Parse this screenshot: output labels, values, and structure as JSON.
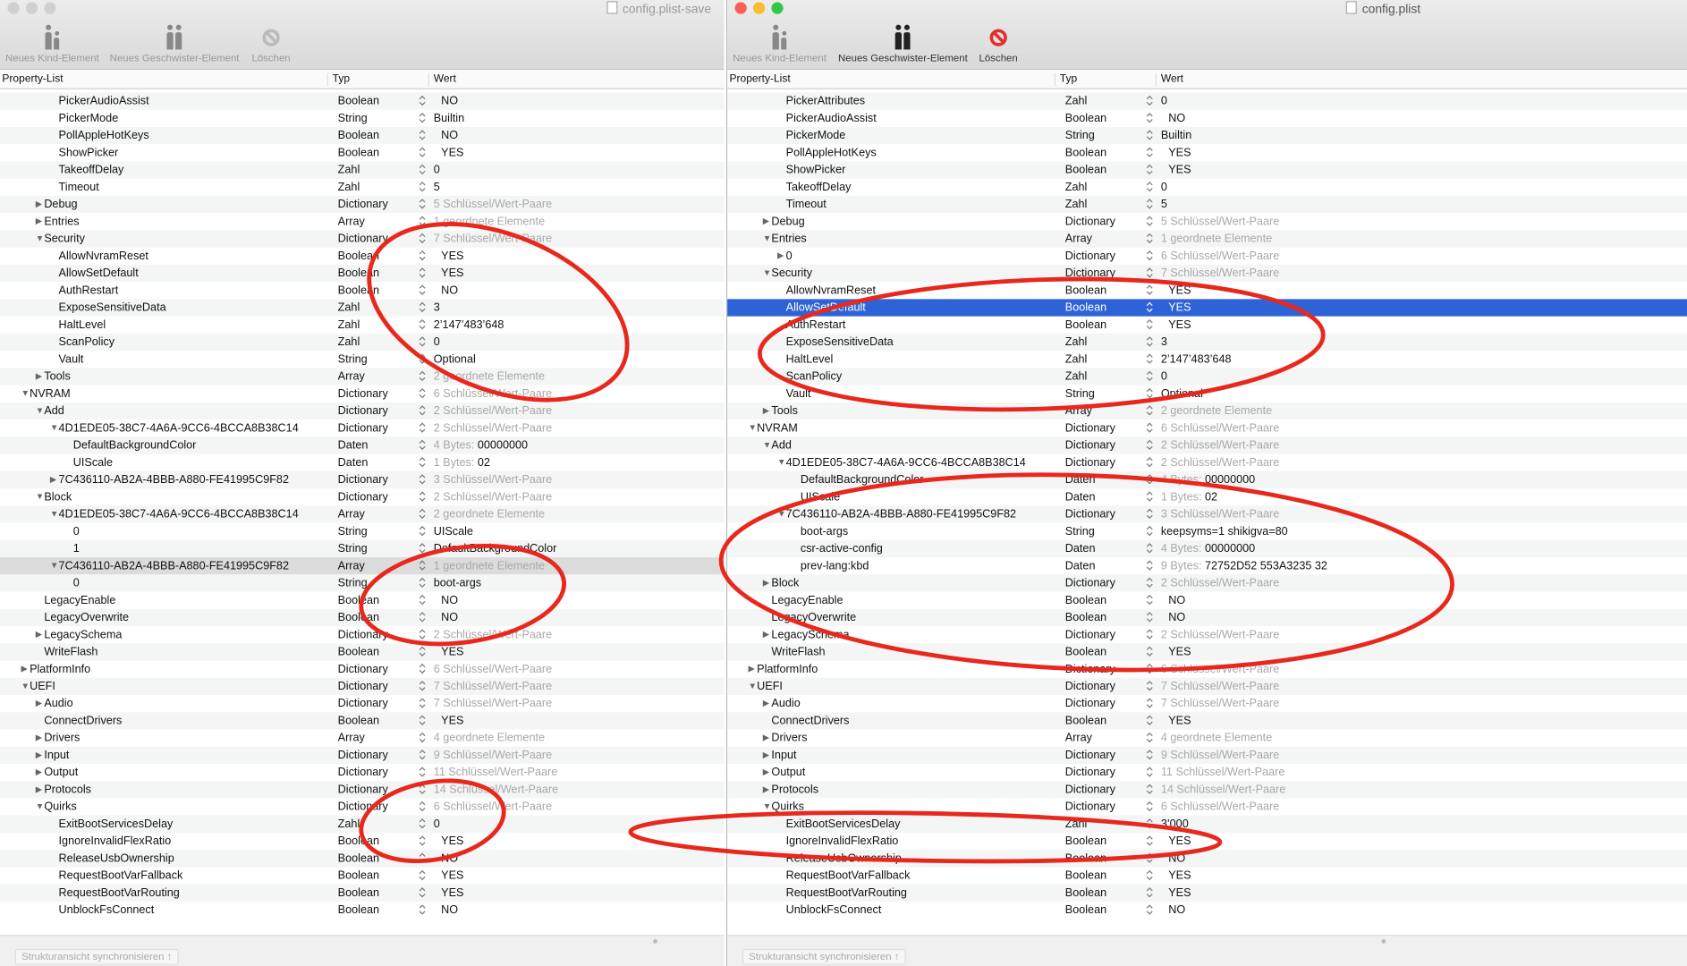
{
  "left": {
    "title": "config.plist-save",
    "toolbar": [
      "Neues Kind-Element",
      "Neues Geschwister-Element",
      "Löschen"
    ],
    "columns": [
      "Property-List",
      "Typ",
      "Wert"
    ],
    "sync": "Strukturansicht synchronisieren ↑",
    "rows": [
      [
        3,
        "",
        "PickerAudioAssist",
        "Boolean",
        "",
        "NO"
      ],
      [
        3,
        "",
        "PickerMode",
        "String",
        "",
        "Builtin"
      ],
      [
        3,
        "",
        "PollAppleHotKeys",
        "Boolean",
        "",
        "NO"
      ],
      [
        3,
        "",
        "ShowPicker",
        "Boolean",
        "",
        "YES"
      ],
      [
        3,
        "",
        "TakeoffDelay",
        "Zahl",
        "",
        "0"
      ],
      [
        3,
        "",
        "Timeout",
        "Zahl",
        "",
        "5"
      ],
      [
        2,
        "c",
        "Debug",
        "Dictionary",
        "5 Schlüssel/Wert-Paare",
        ""
      ],
      [
        2,
        "c",
        "Entries",
        "Array",
        "1 geordnete Elemente",
        ""
      ],
      [
        2,
        "o",
        "Security",
        "Dictionary",
        "7 Schlüssel/Wert-Paare",
        ""
      ],
      [
        3,
        "",
        "AllowNvramReset",
        "Boolean",
        "",
        "YES"
      ],
      [
        3,
        "",
        "AllowSetDefault",
        "Boolean",
        "",
        "YES"
      ],
      [
        3,
        "",
        "AuthRestart",
        "Boolean",
        "",
        "NO"
      ],
      [
        3,
        "",
        "ExposeSensitiveData",
        "Zahl",
        "",
        "3"
      ],
      [
        3,
        "",
        "HaltLevel",
        "Zahl",
        "",
        "2’147’483’648"
      ],
      [
        3,
        "",
        "ScanPolicy",
        "Zahl",
        "",
        "0"
      ],
      [
        3,
        "",
        "Vault",
        "String",
        "",
        "Optional"
      ],
      [
        2,
        "c",
        "Tools",
        "Array",
        "2 geordnete Elemente",
        ""
      ],
      [
        1,
        "o",
        "NVRAM",
        "Dictionary",
        "6 Schlüssel/Wert-Paare",
        ""
      ],
      [
        2,
        "o",
        "Add",
        "Dictionary",
        "2 Schlüssel/Wert-Paare",
        ""
      ],
      [
        3,
        "o",
        "4D1EDE05-38C7-4A6A-9CC6-4BCCA8B38C14",
        "Dictionary",
        "2 Schlüssel/Wert-Paare",
        ""
      ],
      [
        4,
        "",
        "DefaultBackgroundColor",
        "Daten",
        "4 Bytes:",
        "00000000"
      ],
      [
        4,
        "",
        "UIScale",
        "Daten",
        "1 Bytes:",
        "02"
      ],
      [
        3,
        "c",
        "7C436110-AB2A-4BBB-A880-FE41995C9F82",
        "Dictionary",
        "3 Schlüssel/Wert-Paare",
        ""
      ],
      [
        2,
        "o",
        "Block",
        "Dictionary",
        "2 Schlüssel/Wert-Paare",
        ""
      ],
      [
        3,
        "o",
        "4D1EDE05-38C7-4A6A-9CC6-4BCCA8B38C14",
        "Array",
        "2 geordnete Elemente",
        ""
      ],
      [
        4,
        "",
        "0",
        "String",
        "",
        "UIScale"
      ],
      [
        4,
        "",
        "1",
        "String",
        "",
        "DefaultBackgroundColor"
      ],
      [
        3,
        "o",
        "7C436110-AB2A-4BBB-A880-FE41995C9F82",
        "Array",
        "1 geordnete Elemente",
        "",
        "grey"
      ],
      [
        4,
        "",
        "0",
        "String",
        "",
        "boot-args"
      ],
      [
        2,
        "",
        "LegacyEnable",
        "Boolean",
        "",
        "NO"
      ],
      [
        2,
        "",
        "LegacyOverwrite",
        "Boolean",
        "",
        "NO"
      ],
      [
        2,
        "c",
        "LegacySchema",
        "Dictionary",
        "2 Schlüssel/Wert-Paare",
        ""
      ],
      [
        2,
        "",
        "WriteFlash",
        "Boolean",
        "",
        "YES"
      ],
      [
        1,
        "c",
        "PlatformInfo",
        "Dictionary",
        "6 Schlüssel/Wert-Paare",
        ""
      ],
      [
        1,
        "o",
        "UEFI",
        "Dictionary",
        "7 Schlüssel/Wert-Paare",
        ""
      ],
      [
        2,
        "c",
        "Audio",
        "Dictionary",
        "7 Schlüssel/Wert-Paare",
        ""
      ],
      [
        2,
        "",
        "ConnectDrivers",
        "Boolean",
        "",
        "YES"
      ],
      [
        2,
        "c",
        "Drivers",
        "Array",
        "4 geordnete Elemente",
        ""
      ],
      [
        2,
        "c",
        "Input",
        "Dictionary",
        "9 Schlüssel/Wert-Paare",
        ""
      ],
      [
        2,
        "c",
        "Output",
        "Dictionary",
        "11 Schlüssel/Wert-Paare",
        ""
      ],
      [
        2,
        "c",
        "Protocols",
        "Dictionary",
        "14 Schlüssel/Wert-Paare",
        ""
      ],
      [
        2,
        "o",
        "Quirks",
        "Dictionary",
        "6 Schlüssel/Wert-Paare",
        ""
      ],
      [
        3,
        "",
        "ExitBootServicesDelay",
        "Zahl",
        "",
        "0"
      ],
      [
        3,
        "",
        "IgnoreInvalidFlexRatio",
        "Boolean",
        "",
        "YES"
      ],
      [
        3,
        "",
        "ReleaseUsbOwnership",
        "Boolean",
        "",
        "NO"
      ],
      [
        3,
        "",
        "RequestBootVarFallback",
        "Boolean",
        "",
        "YES"
      ],
      [
        3,
        "",
        "RequestBootVarRouting",
        "Boolean",
        "",
        "YES"
      ],
      [
        3,
        "",
        "UnblockFsConnect",
        "Boolean",
        "",
        "NO"
      ]
    ]
  },
  "right": {
    "title": "config.plist",
    "toolbar": [
      "Neues Kind-Element",
      "Neues Geschwister-Element",
      "Löschen"
    ],
    "columns": [
      "Property-List",
      "Typ",
      "Wert"
    ],
    "sync": "Strukturansicht synchronisieren ↑",
    "rows": [
      [
        3,
        "",
        "PickerAttributes",
        "Zahl",
        "",
        "0"
      ],
      [
        3,
        "",
        "PickerAudioAssist",
        "Boolean",
        "",
        "NO"
      ],
      [
        3,
        "",
        "PickerMode",
        "String",
        "",
        "Builtin"
      ],
      [
        3,
        "",
        "PollAppleHotKeys",
        "Boolean",
        "",
        "YES"
      ],
      [
        3,
        "",
        "ShowPicker",
        "Boolean",
        "",
        "YES"
      ],
      [
        3,
        "",
        "TakeoffDelay",
        "Zahl",
        "",
        "0"
      ],
      [
        3,
        "",
        "Timeout",
        "Zahl",
        "",
        "5"
      ],
      [
        2,
        "c",
        "Debug",
        "Dictionary",
        "5 Schlüssel/Wert-Paare",
        ""
      ],
      [
        2,
        "o",
        "Entries",
        "Array",
        "1 geordnete Elemente",
        ""
      ],
      [
        3,
        "c",
        "0",
        "Dictionary",
        "6 Schlüssel/Wert-Paare",
        ""
      ],
      [
        2,
        "o",
        "Security",
        "Dictionary",
        "7 Schlüssel/Wert-Paare",
        ""
      ],
      [
        3,
        "",
        "AllowNvramReset",
        "Boolean",
        "",
        "YES"
      ],
      [
        3,
        "",
        "AllowSetDefault",
        "Boolean",
        "",
        "YES",
        "sel"
      ],
      [
        3,
        "",
        "AuthRestart",
        "Boolean",
        "",
        "YES"
      ],
      [
        3,
        "",
        "ExposeSensitiveData",
        "Zahl",
        "",
        "3"
      ],
      [
        3,
        "",
        "HaltLevel",
        "Zahl",
        "",
        "2’147’483’648"
      ],
      [
        3,
        "",
        "ScanPolicy",
        "Zahl",
        "",
        "0"
      ],
      [
        3,
        "",
        "Vault",
        "String",
        "",
        "Optional"
      ],
      [
        2,
        "c",
        "Tools",
        "Array",
        "2 geordnete Elemente",
        ""
      ],
      [
        1,
        "o",
        "NVRAM",
        "Dictionary",
        "6 Schlüssel/Wert-Paare",
        ""
      ],
      [
        2,
        "o",
        "Add",
        "Dictionary",
        "2 Schlüssel/Wert-Paare",
        ""
      ],
      [
        3,
        "o",
        "4D1EDE05-38C7-4A6A-9CC6-4BCCA8B38C14",
        "Dictionary",
        "2 Schlüssel/Wert-Paare",
        ""
      ],
      [
        4,
        "",
        "DefaultBackgroundColor",
        "Daten",
        "4 Bytes:",
        "00000000"
      ],
      [
        4,
        "",
        "UIScale",
        "Daten",
        "1 Bytes:",
        "02"
      ],
      [
        3,
        "o",
        "7C436110-AB2A-4BBB-A880-FE41995C9F82",
        "Dictionary",
        "3 Schlüssel/Wert-Paare",
        ""
      ],
      [
        4,
        "",
        "boot-args",
        "String",
        "",
        "keepsyms=1 shikigva=80"
      ],
      [
        4,
        "",
        "csr-active-config",
        "Daten",
        "4 Bytes:",
        "00000000"
      ],
      [
        4,
        "",
        "prev-lang:kbd",
        "Daten",
        "9 Bytes:",
        "72752D52 553A3235 32"
      ],
      [
        2,
        "c",
        "Block",
        "Dictionary",
        "2 Schlüssel/Wert-Paare",
        ""
      ],
      [
        2,
        "",
        "LegacyEnable",
        "Boolean",
        "",
        "NO"
      ],
      [
        2,
        "",
        "LegacyOverwrite",
        "Boolean",
        "",
        "NO"
      ],
      [
        2,
        "c",
        "LegacySchema",
        "Dictionary",
        "2 Schlüssel/Wert-Paare",
        ""
      ],
      [
        2,
        "",
        "WriteFlash",
        "Boolean",
        "",
        "YES"
      ],
      [
        1,
        "c",
        "PlatformInfo",
        "Dictionary",
        "6 Schlüssel/Wert-Paare",
        ""
      ],
      [
        1,
        "o",
        "UEFI",
        "Dictionary",
        "7 Schlüssel/Wert-Paare",
        ""
      ],
      [
        2,
        "c",
        "Audio",
        "Dictionary",
        "7 Schlüssel/Wert-Paare",
        ""
      ],
      [
        2,
        "",
        "ConnectDrivers",
        "Boolean",
        "",
        "YES"
      ],
      [
        2,
        "c",
        "Drivers",
        "Array",
        "4 geordnete Elemente",
        ""
      ],
      [
        2,
        "c",
        "Input",
        "Dictionary",
        "9 Schlüssel/Wert-Paare",
        ""
      ],
      [
        2,
        "c",
        "Output",
        "Dictionary",
        "11 Schlüssel/Wert-Paare",
        ""
      ],
      [
        2,
        "c",
        "Protocols",
        "Dictionary",
        "14 Schlüssel/Wert-Paare",
        ""
      ],
      [
        2,
        "o",
        "Quirks",
        "Dictionary",
        "6 Schlüssel/Wert-Paare",
        ""
      ],
      [
        3,
        "",
        "ExitBootServicesDelay",
        "Zahl",
        "",
        "3’000"
      ],
      [
        3,
        "",
        "IgnoreInvalidFlexRatio",
        "Boolean",
        "",
        "YES"
      ],
      [
        3,
        "",
        "ReleaseUsbOwnership",
        "Boolean",
        "",
        "NO"
      ],
      [
        3,
        "",
        "RequestBootVarFallback",
        "Boolean",
        "",
        "YES"
      ],
      [
        3,
        "",
        "RequestBootVarRouting",
        "Boolean",
        "",
        "YES"
      ],
      [
        3,
        "",
        "UnblockFsConnect",
        "Boolean",
        "",
        "NO"
      ]
    ]
  },
  "annotation_color": "#e8281c"
}
